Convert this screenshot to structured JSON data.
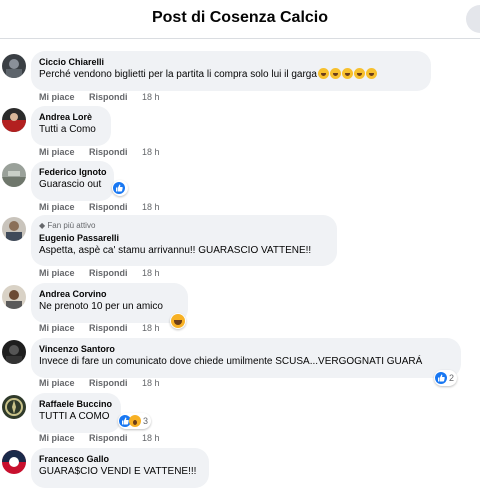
{
  "header": {
    "title": "Post di Cosenza Calcio"
  },
  "actions": {
    "like": "Mi piace",
    "reply": "Rispondi"
  },
  "comments": [
    {
      "author": "Ciccio Chiarelli",
      "text": "Perché vendono biglietti per la partita li compra solo lui il garga",
      "time": "18 h",
      "emoji_count": 5
    },
    {
      "author": "Andrea Lorè",
      "text": "Tutti a Como",
      "time": "18 h"
    },
    {
      "author": "Federico Ignoto",
      "text": "Guarascio out",
      "time": "18 h",
      "reaction": "like"
    },
    {
      "author": "Eugenio Passarelli",
      "badge": "Fan più attivo",
      "text": "Aspetta, aspè ca' stamu arrivannu!! GUARASCIO VATTENE!!",
      "time": "18 h"
    },
    {
      "author": "Andrea Corvino",
      "text": "Ne prenoto 10 per un amico",
      "time": "18 h",
      "reaction": "haha"
    },
    {
      "author": "Vincenzo Santoro",
      "text": "Invece di fare un comunicato dove chiede umilmente SCUSA...VERGOGNATI GUARÁ",
      "time": "18 h",
      "reaction": "like",
      "reaction_count": "2"
    },
    {
      "author": "Raffaele Buccino",
      "text": "TUTTI A COMO",
      "time": "18 h",
      "reaction": "like+wow",
      "reaction_count": "3"
    },
    {
      "author": "Francesco Gallo",
      "text": "GUARA$CIO VENDI E VATTENE!!!"
    }
  ],
  "colors": {
    "bubble": "#f0f2f5",
    "like": "#1877f2",
    "meta": "#65676b"
  }
}
